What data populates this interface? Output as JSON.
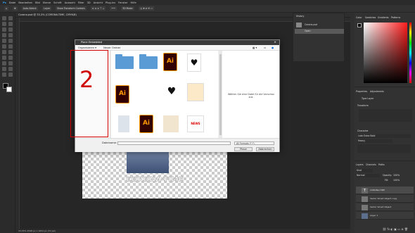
{
  "menubar": {
    "items": [
      "Ps",
      "Datei",
      "Bearbeiten",
      "Bild",
      "Ebene",
      "Schrift",
      "Auswahl",
      "Filter",
      "3D",
      "Ansicht",
      "Plug-ins",
      "Fenster",
      "Hilfe"
    ]
  },
  "optionsbar": {
    "auto_select": "Auto-Select:",
    "layer": "Layer",
    "show_transform": "Show Transform Controls",
    "mode_3d": "3D Mode:"
  },
  "document": {
    "tab": "Corona.psd @ 33,3% (CORONA-TIME, CMYK/8)",
    "status": "33,33%   2598 px x 1654 px (72 ppi)",
    "title_text": "CORONA-TIME"
  },
  "dialog": {
    "title": "Place Embedded",
    "close": "×",
    "organize": "Organisieren ▾",
    "new_folder": "Neuer Ordner",
    "preview_hint": "Wählen Sie eine Datei für die Vorschau aus.",
    "filename_label": "Dateiname:",
    "filetype": "All Formats (*.*)",
    "place_btn": "Place",
    "cancel_btn": "Abbrechen",
    "thumbs": [
      {
        "kind": "folder"
      },
      {
        "kind": "folder"
      },
      {
        "kind": "ai"
      },
      {
        "kind": "pic-heart"
      },
      {
        "kind": "ai"
      },
      {
        "kind": "pic-small"
      },
      {
        "kind": "pic-heart2"
      },
      {
        "kind": "pic-arrow"
      },
      {
        "kind": "pic-person"
      },
      {
        "kind": "ai"
      },
      {
        "kind": "pic-dog"
      },
      {
        "kind": "pic-news"
      }
    ],
    "ai_label": "Ai",
    "news_label": "NEWS",
    "red_annotation": "2"
  },
  "panels": {
    "history_title": "History",
    "history_items": [
      "Corona.psd",
      "Open"
    ],
    "color_tabs": [
      "Color",
      "Swatches",
      "Gradients",
      "Patterns"
    ],
    "props_tabs": [
      "Properties",
      "Adjustments"
    ],
    "props_type_layer": "Type Layer",
    "props_transform": "Transform",
    "props_character": "Character",
    "font_name": "Lato Extra Bold",
    "font_style": "Heavy",
    "layers_tabs": [
      "Layers",
      "Channels",
      "Paths"
    ],
    "layer_kind": "Kind",
    "blend_mode": "Normal",
    "opacity_label": "Opacity:",
    "opacity": "100%",
    "fill_label": "Fill:",
    "fill": "100%",
    "layers": [
      "CORONA-TIME",
      "Vector Smart Object copy",
      "Vector Smart Object",
      "Layer 1"
    ]
  }
}
